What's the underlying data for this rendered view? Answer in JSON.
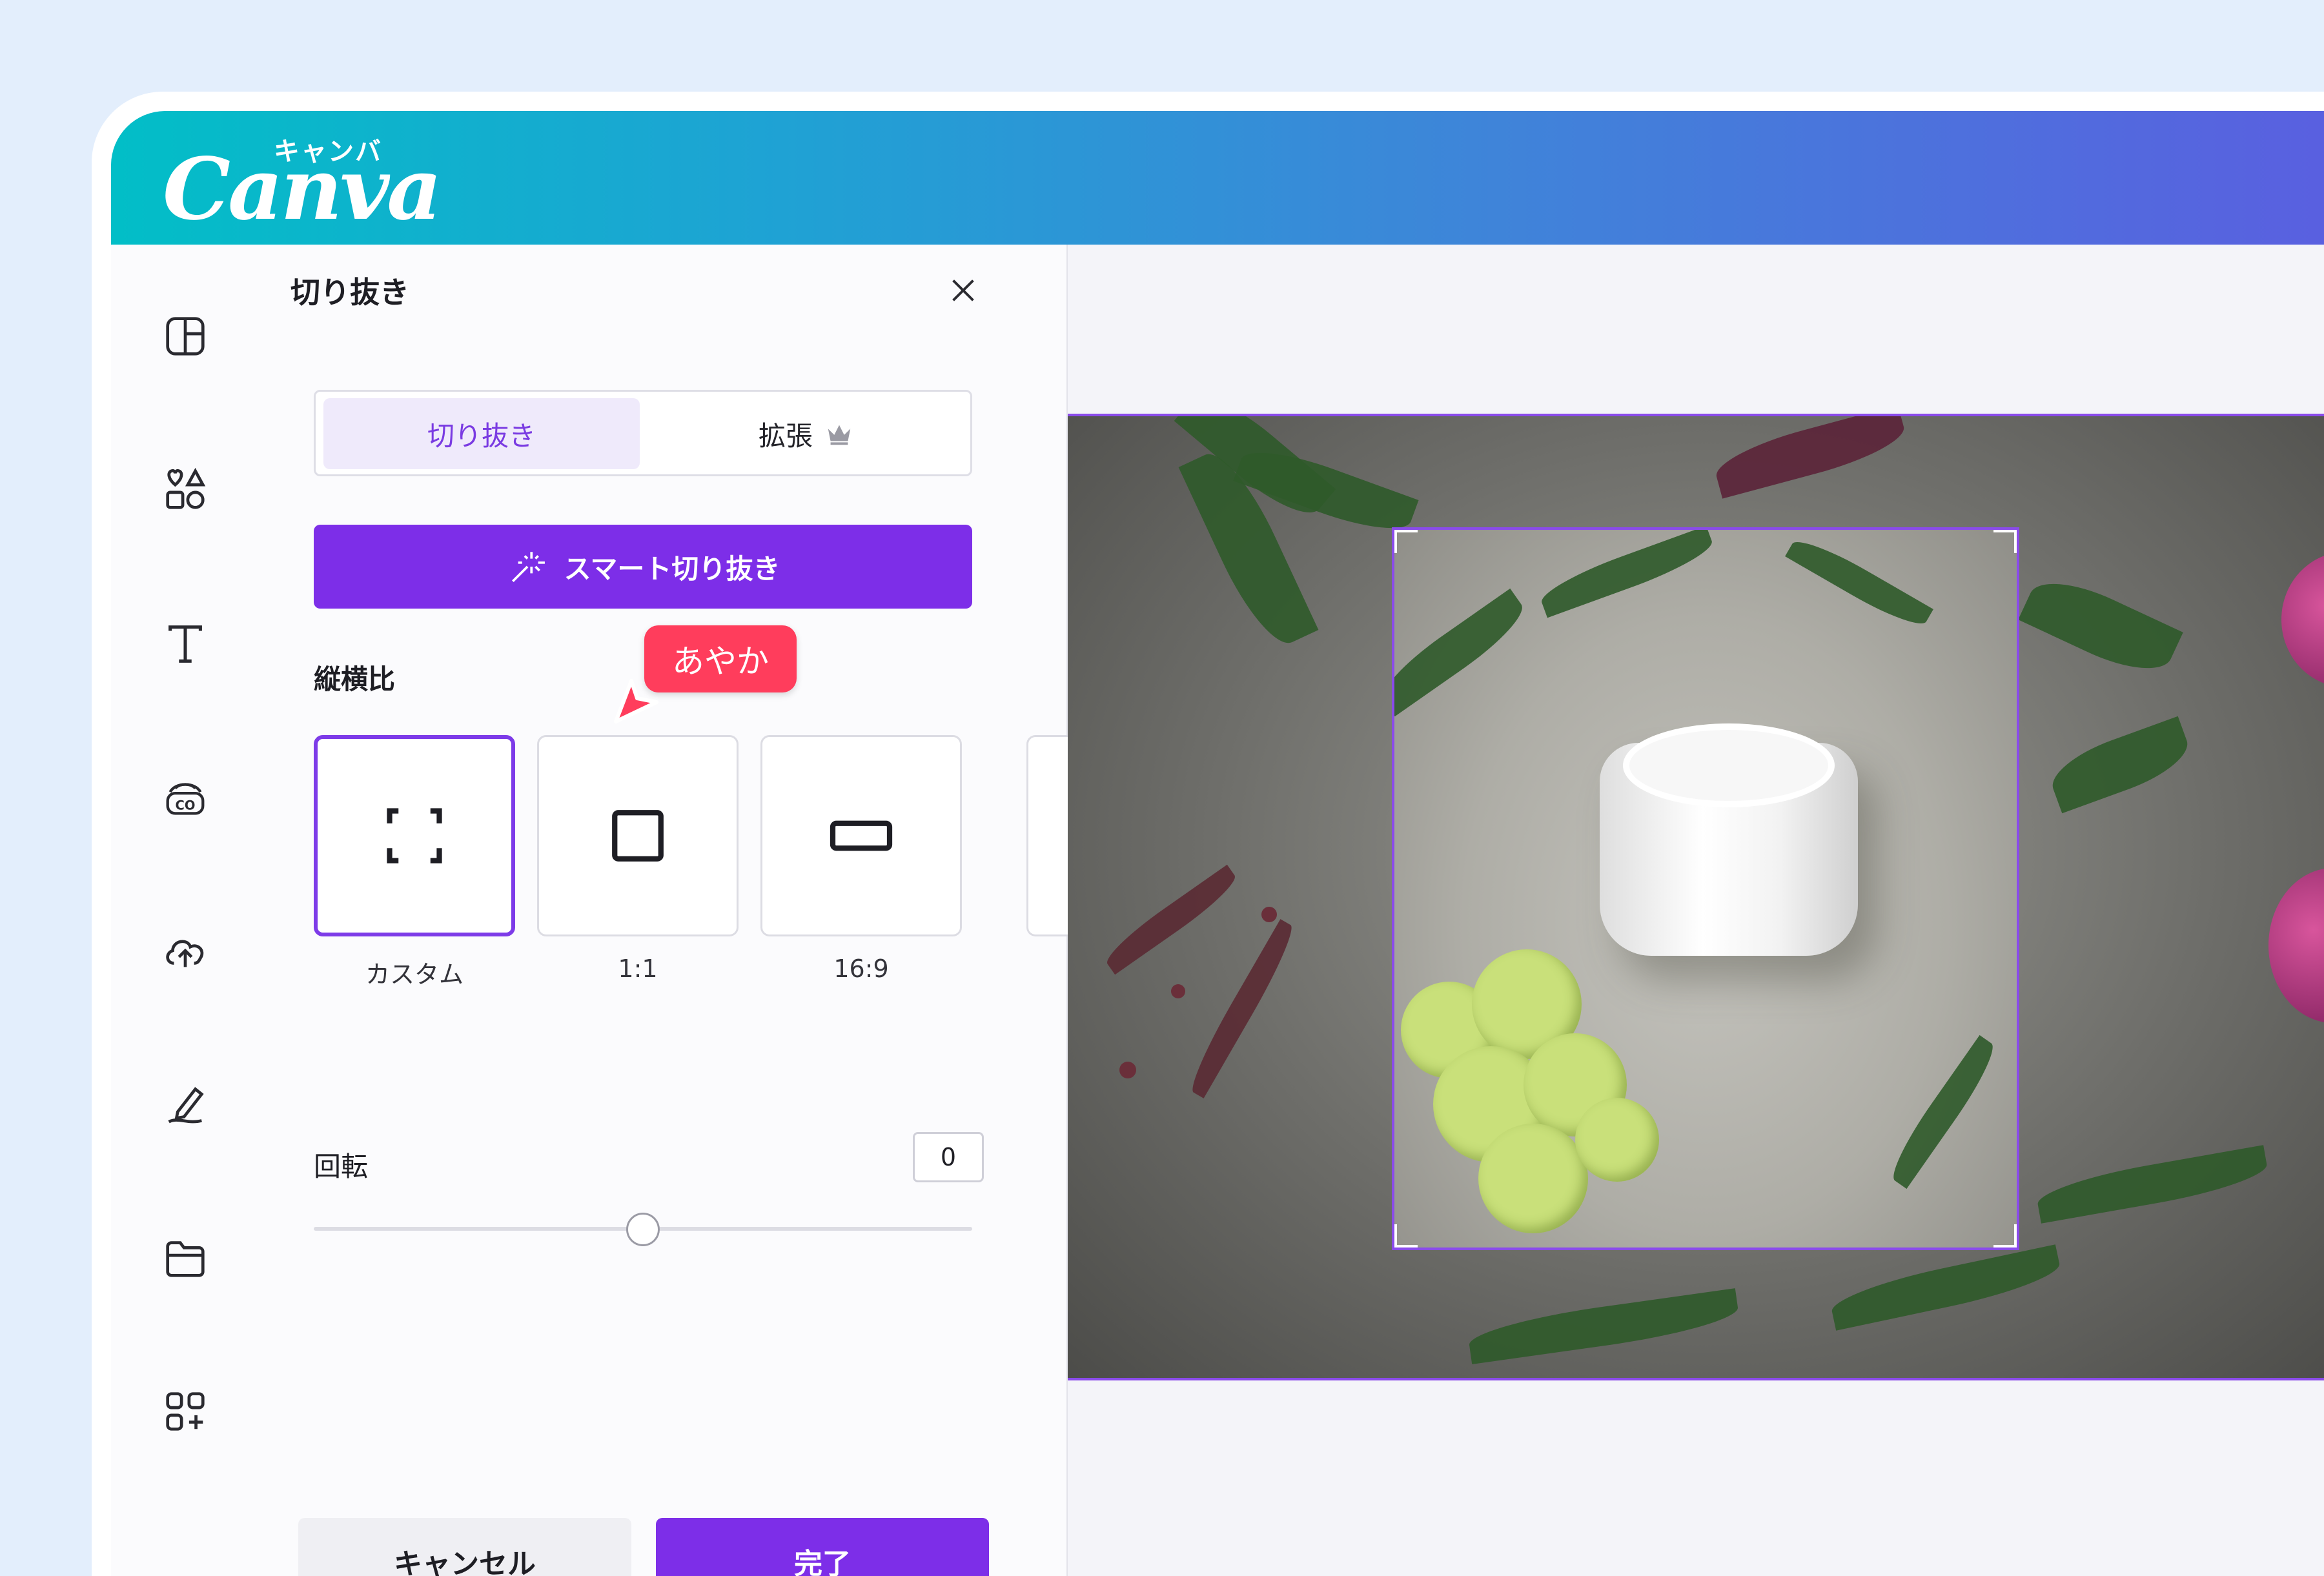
{
  "brand": {
    "logo": "Canva",
    "kana": "キャンバ"
  },
  "panel": {
    "title": "切り抜き",
    "tabs": [
      {
        "label": "切り抜き",
        "active": true
      },
      {
        "label": "拡張",
        "icon": "crown-icon"
      }
    ],
    "smart_crop_label": "スマート切り抜き",
    "ratio_heading": "縦横比",
    "ratios": [
      {
        "label": "カスタム",
        "selected": true,
        "icon": "custom-ratio-icon"
      },
      {
        "label": "1:1",
        "icon": "square-ratio-icon"
      },
      {
        "label": "16:9",
        "icon": "wide-ratio-icon"
      }
    ],
    "rotation_label": "回転",
    "rotation_value": "0",
    "rotation_slider_fraction": 0.5,
    "cancel_label": "キャンセル",
    "done_label": "完了"
  },
  "collaborator": {
    "name": "あやか",
    "color": "#ff3d5c"
  },
  "colors": {
    "accent": "#7d2ee8",
    "selection": "#8a4bea"
  },
  "rail_icons": [
    "design-icon",
    "elements-icon",
    "text-icon",
    "brand-icon",
    "uploads-icon",
    "draw-icon",
    "projects-icon",
    "apps-icon"
  ]
}
